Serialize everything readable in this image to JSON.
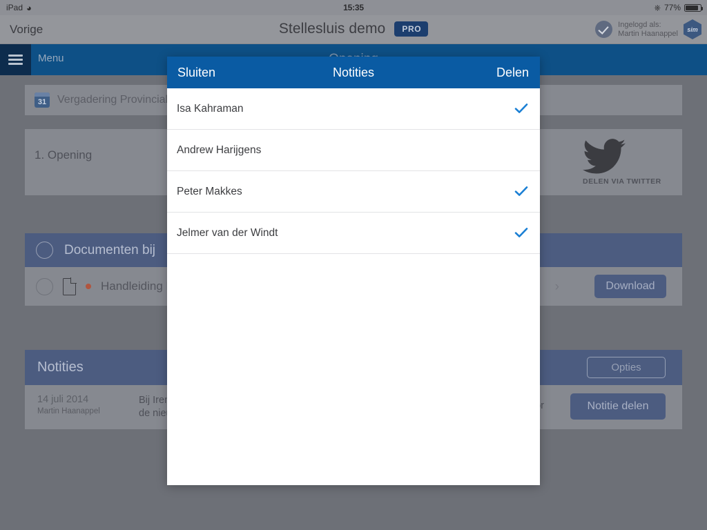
{
  "statusbar": {
    "device": "iPad",
    "wifi_icon": "wifi-icon",
    "time": "15:35",
    "bluetooth_icon": "bluetooth-icon",
    "battery_percent": "77%",
    "battery_icon": "battery-icon"
  },
  "appheader": {
    "back_label": "Vorige",
    "title": "Stellesluis demo",
    "pro_badge": "PRO",
    "verified_icon": "check-circle-icon",
    "account_line1": "Ingelogd als:",
    "account_line2": "Martin Haanappel",
    "logo_text": "sim",
    "logo_icon": "sim-hexagon-logo"
  },
  "navbar": {
    "menu_icon": "hamburger-menu-icon",
    "menu_label": "Menu",
    "center_title": "Opening"
  },
  "content": {
    "meeting": {
      "calendar_icon": "calendar-icon",
      "calendar_day": "31",
      "label": "Vergadering Provinciale St"
    },
    "agenda_item": {
      "label": "1. Opening"
    },
    "twitter": {
      "icon": "twitter-bird-icon",
      "label": "DELEN VIA TWITTER"
    },
    "documents": {
      "header_label": "Documenten bij",
      "header_checkbox_icon": "circle-checkbox-icon",
      "row": {
        "checkbox_icon": "circle-checkbox-icon",
        "file_icon": "document-file-icon",
        "unread_dot": "unread-dot-icon",
        "label": "Handleiding Ra",
        "chevron_icon": "chevron-right-icon",
        "download_label": "Download"
      }
    },
    "notes": {
      "header_label": "Notities",
      "options_label": "Opties",
      "entry": {
        "date": "14 juli 2014",
        "author": "Martin Haanappel",
        "text_line1": "Bij Irene navr",
        "text_line2": "de nieuwe ve",
        "text_tail": "d voor"
      },
      "share_note_label": "Notitie delen"
    }
  },
  "modal": {
    "close_label": "Sluiten",
    "title": "Notities",
    "share_label": "Delen",
    "check_icon": "checkmark-icon",
    "accent_color": "#0a5ba3",
    "check_color": "#1a7fd4",
    "people": [
      {
        "name": "Isa Kahraman",
        "selected": true
      },
      {
        "name": "Andrew Harijgens",
        "selected": false
      },
      {
        "name": "Peter Makkes",
        "selected": true
      },
      {
        "name": "Jelmer van der Windt",
        "selected": true
      }
    ]
  }
}
